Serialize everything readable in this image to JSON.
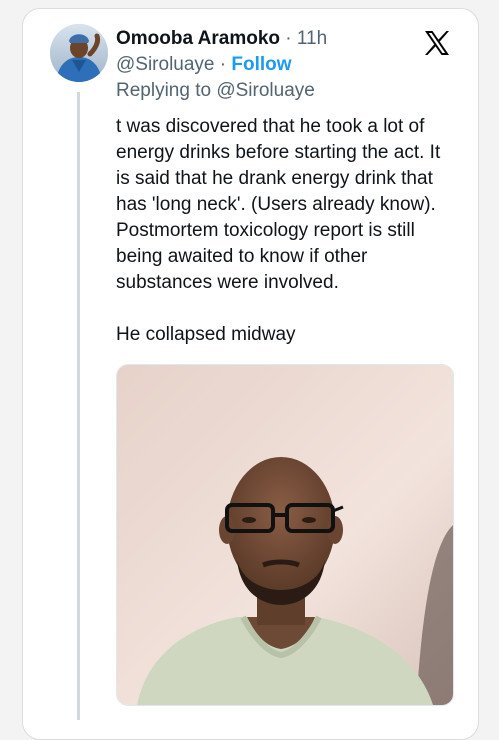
{
  "tweet": {
    "author_name": "Omooba Aramoko",
    "separator": "·",
    "time": "11h",
    "handle": "@Siroluaye",
    "follow_label": "Follow",
    "reply_prefix": "Replying to",
    "reply_to": "@Siroluaye",
    "body_paragraph_1": "t was discovered that he took a lot of energy drinks before starting the act. It is said that he drank energy drink that has 'long neck'. (Users already know). Postmortem toxicology report is still being awaited to know if other substances were involved.",
    "body_paragraph_2": "He collapsed midway"
  },
  "icons": {
    "platform_logo": "x-logo-icon"
  },
  "colors": {
    "link_blue": "#1d9bf0",
    "secondary_text": "#536471",
    "primary_text": "#0f1419",
    "thread_line": "#cfd9de"
  }
}
